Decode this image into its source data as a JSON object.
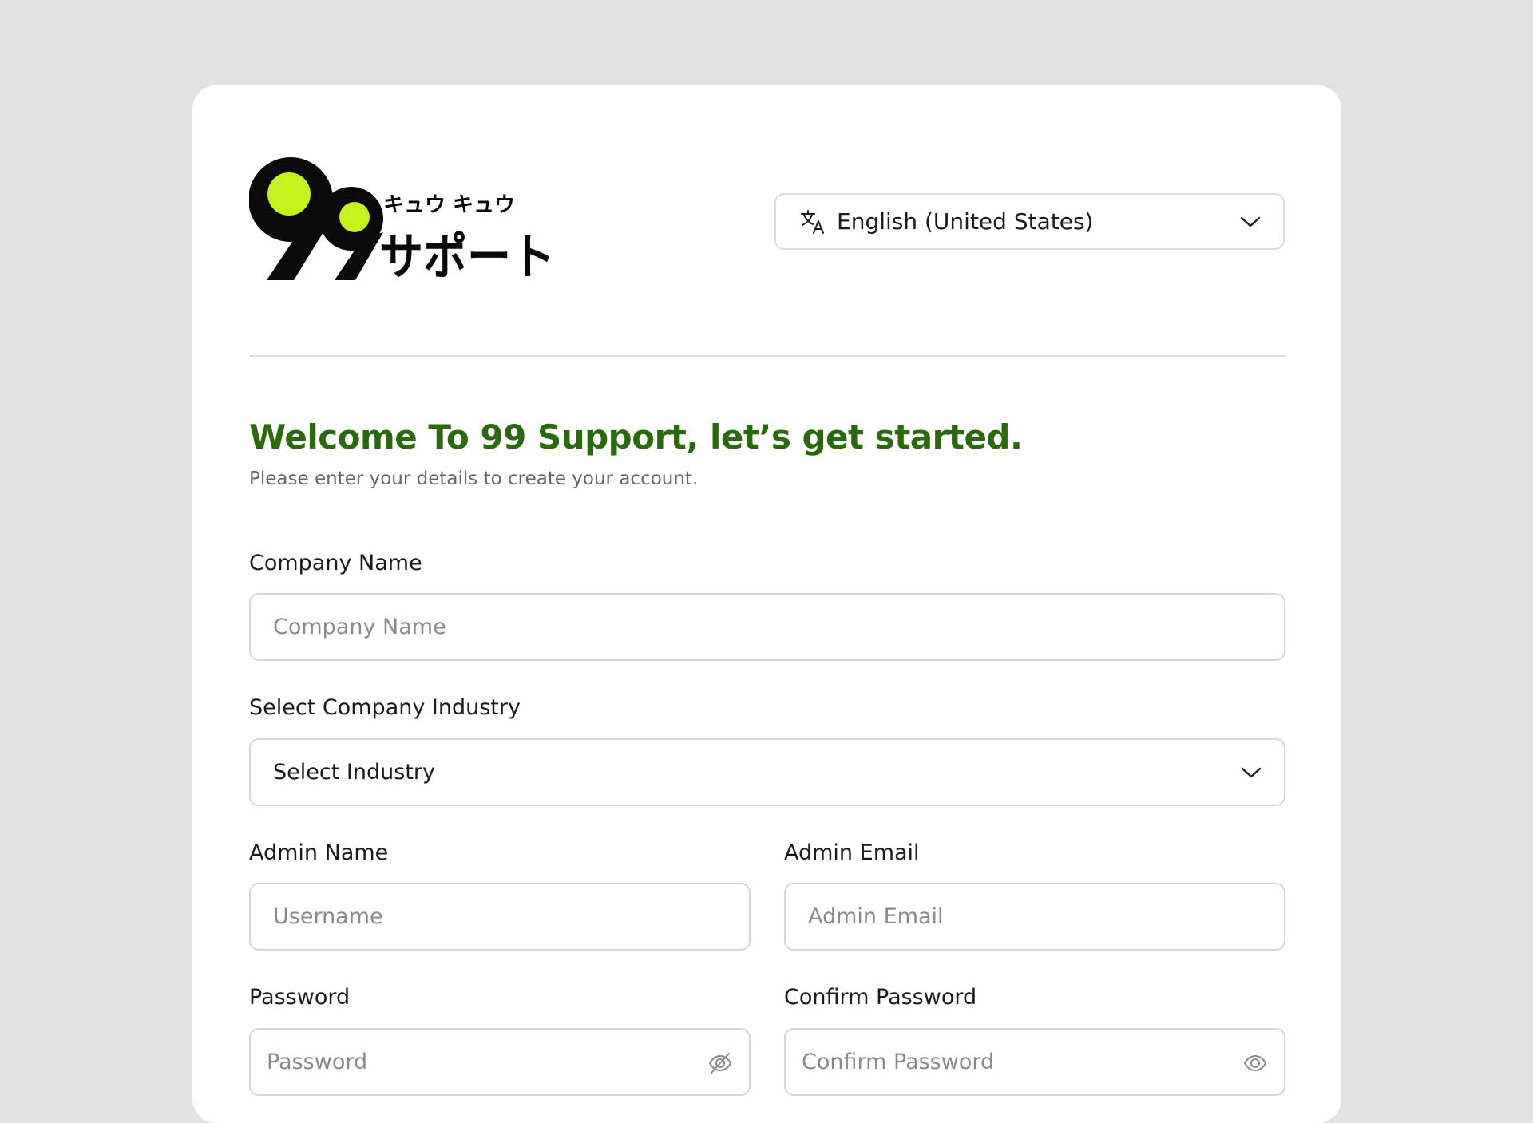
{
  "brand": {
    "kana_top": "キュウ キュウ",
    "logo_text": "99サポート",
    "accent_color": "#c6f21e",
    "title_color": "#2a6a0c"
  },
  "language": {
    "selected": "English (United States)",
    "icon": "translate-icon"
  },
  "welcome": {
    "title": "Welcome To 99 Support, let’s get started.",
    "subtitle": "Please enter your details to create your account."
  },
  "form": {
    "company_name": {
      "label": "Company Name",
      "placeholder": "Company Name",
      "value": ""
    },
    "industry": {
      "label": "Select Company Industry",
      "value": "Select Industry"
    },
    "admin_name": {
      "label": "Admin Name",
      "placeholder": "Username",
      "value": ""
    },
    "admin_email": {
      "label": "Admin Email",
      "placeholder": "Admin Email",
      "value": ""
    },
    "password": {
      "label": "Password",
      "placeholder": "Password",
      "value": "",
      "icon": "eye-slash-icon"
    },
    "confirm_password": {
      "label": "Confirm Password",
      "placeholder": "Confirm Password",
      "value": "",
      "icon": "eye-icon"
    }
  }
}
